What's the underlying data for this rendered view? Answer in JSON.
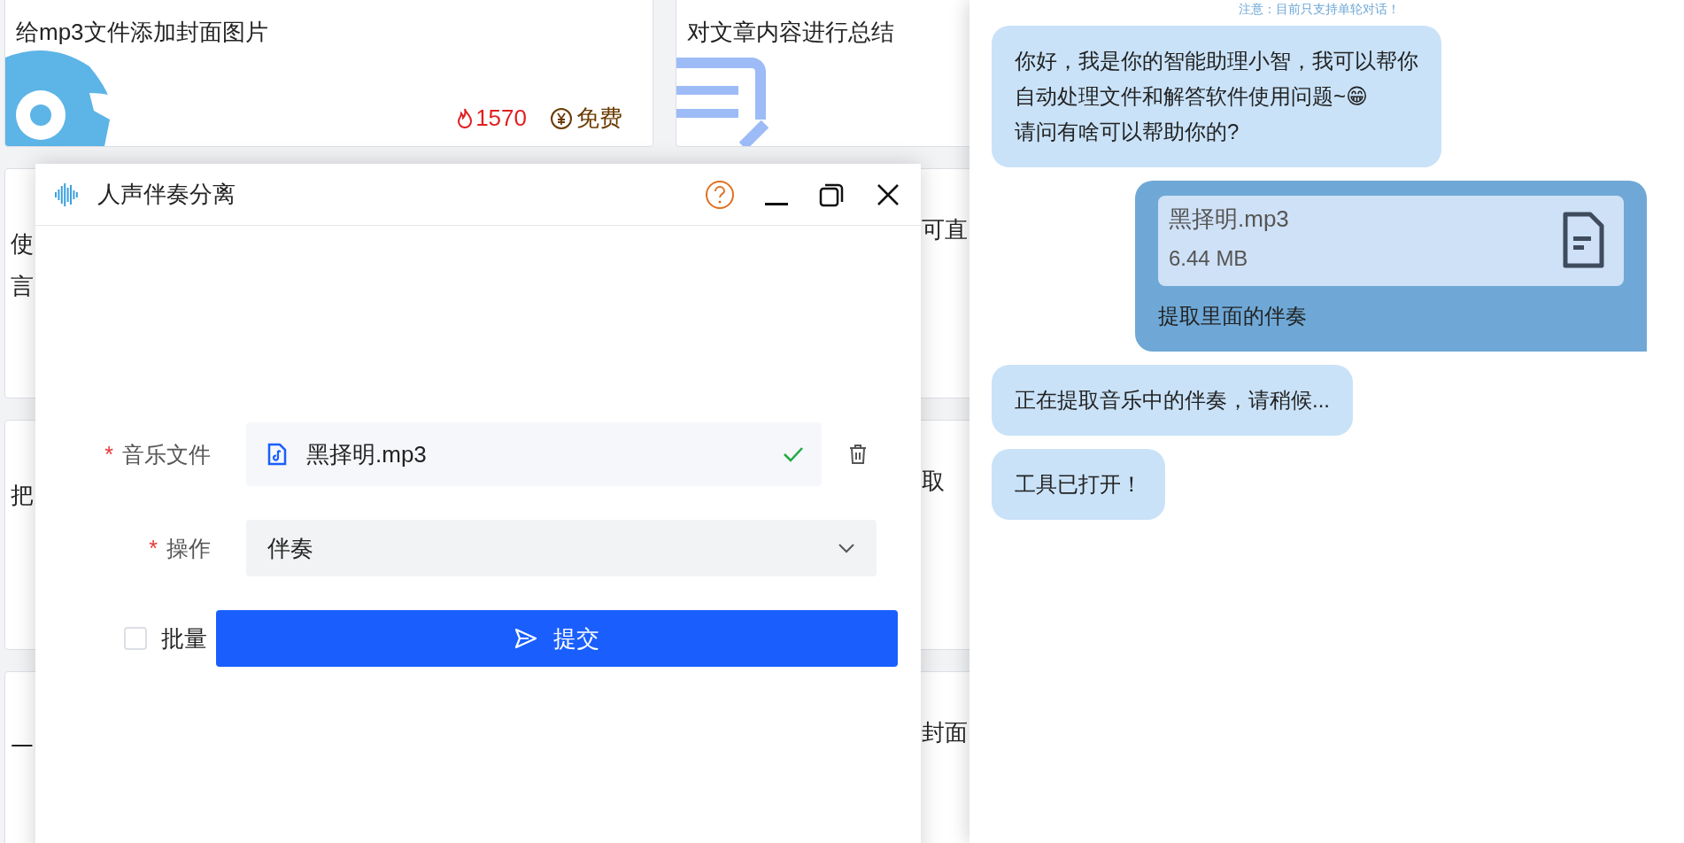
{
  "tool_cards": [
    {
      "title": "给mp3文件添加封面图片",
      "hot": "1570",
      "price": "免费",
      "kind": "disc"
    },
    {
      "title": "对文章内容进行总结",
      "kind": "doc"
    }
  ],
  "covered_rows": [
    {
      "left_texts": [
        "使",
        "言"
      ],
      "right_texts": [
        "可直"
      ]
    },
    {
      "left_texts": [
        "把"
      ],
      "right_texts": [
        "取"
      ]
    },
    {
      "left_texts": [
        "一"
      ],
      "right_texts": [
        "封面"
      ]
    }
  ],
  "dialog": {
    "title": "人声伴奏分离",
    "fields": [
      {
        "kind": "file",
        "required_mark": "*",
        "label": "音乐文件",
        "file_name": "黑择明.mp3",
        "uploaded": true
      },
      {
        "kind": "select",
        "required_mark": "*",
        "label": "操作",
        "value": "伴奏"
      }
    ],
    "batch": {
      "label": "批量",
      "checked": false
    },
    "submit": "提交"
  },
  "chat": {
    "notice": "注意：目前只支持单轮对话！",
    "messages": [
      {
        "kind": "assistant",
        "lines": [
          "你好，我是你的智能助理小智，我可以帮你",
          "自动处理文件和解答软件使用问题~😁",
          "请问有啥可以帮助你的?"
        ]
      },
      {
        "kind": "user",
        "attachment": {
          "name": "黑择明.mp3",
          "size": "6.44 MB"
        },
        "lines": [
          "提取里面的伴奏"
        ]
      },
      {
        "kind": "assistant",
        "lines": [
          "正在提取音乐中的伴奏，请稍候..."
        ]
      },
      {
        "kind": "assistant",
        "lines": [
          "工具已打开！"
        ]
      }
    ]
  }
}
